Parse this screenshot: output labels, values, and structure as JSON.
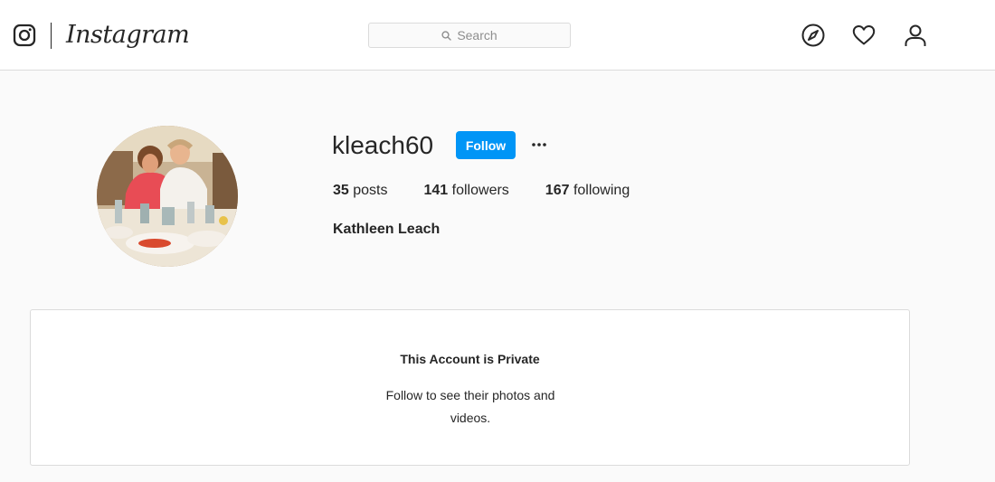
{
  "nav": {
    "logo": "Instagram",
    "search_placeholder": "Search",
    "icons": [
      "camera-icon",
      "compass-icon",
      "heart-icon",
      "user-icon"
    ]
  },
  "profile": {
    "username": "kleach60",
    "follow_label": "Follow",
    "more_label": "···",
    "stats": {
      "posts_count": "35",
      "posts_label": "posts",
      "followers_count": "141",
      "followers_label": "followers",
      "following_count": "167",
      "following_label": "following"
    },
    "full_name": "Kathleen Leach"
  },
  "private": {
    "title": "This Account is Private",
    "message": "Follow to see their photos and videos."
  },
  "colors": {
    "accent": "#0095f6",
    "text": "#262626",
    "border": "#dbdbdb",
    "background": "#fafafa"
  }
}
